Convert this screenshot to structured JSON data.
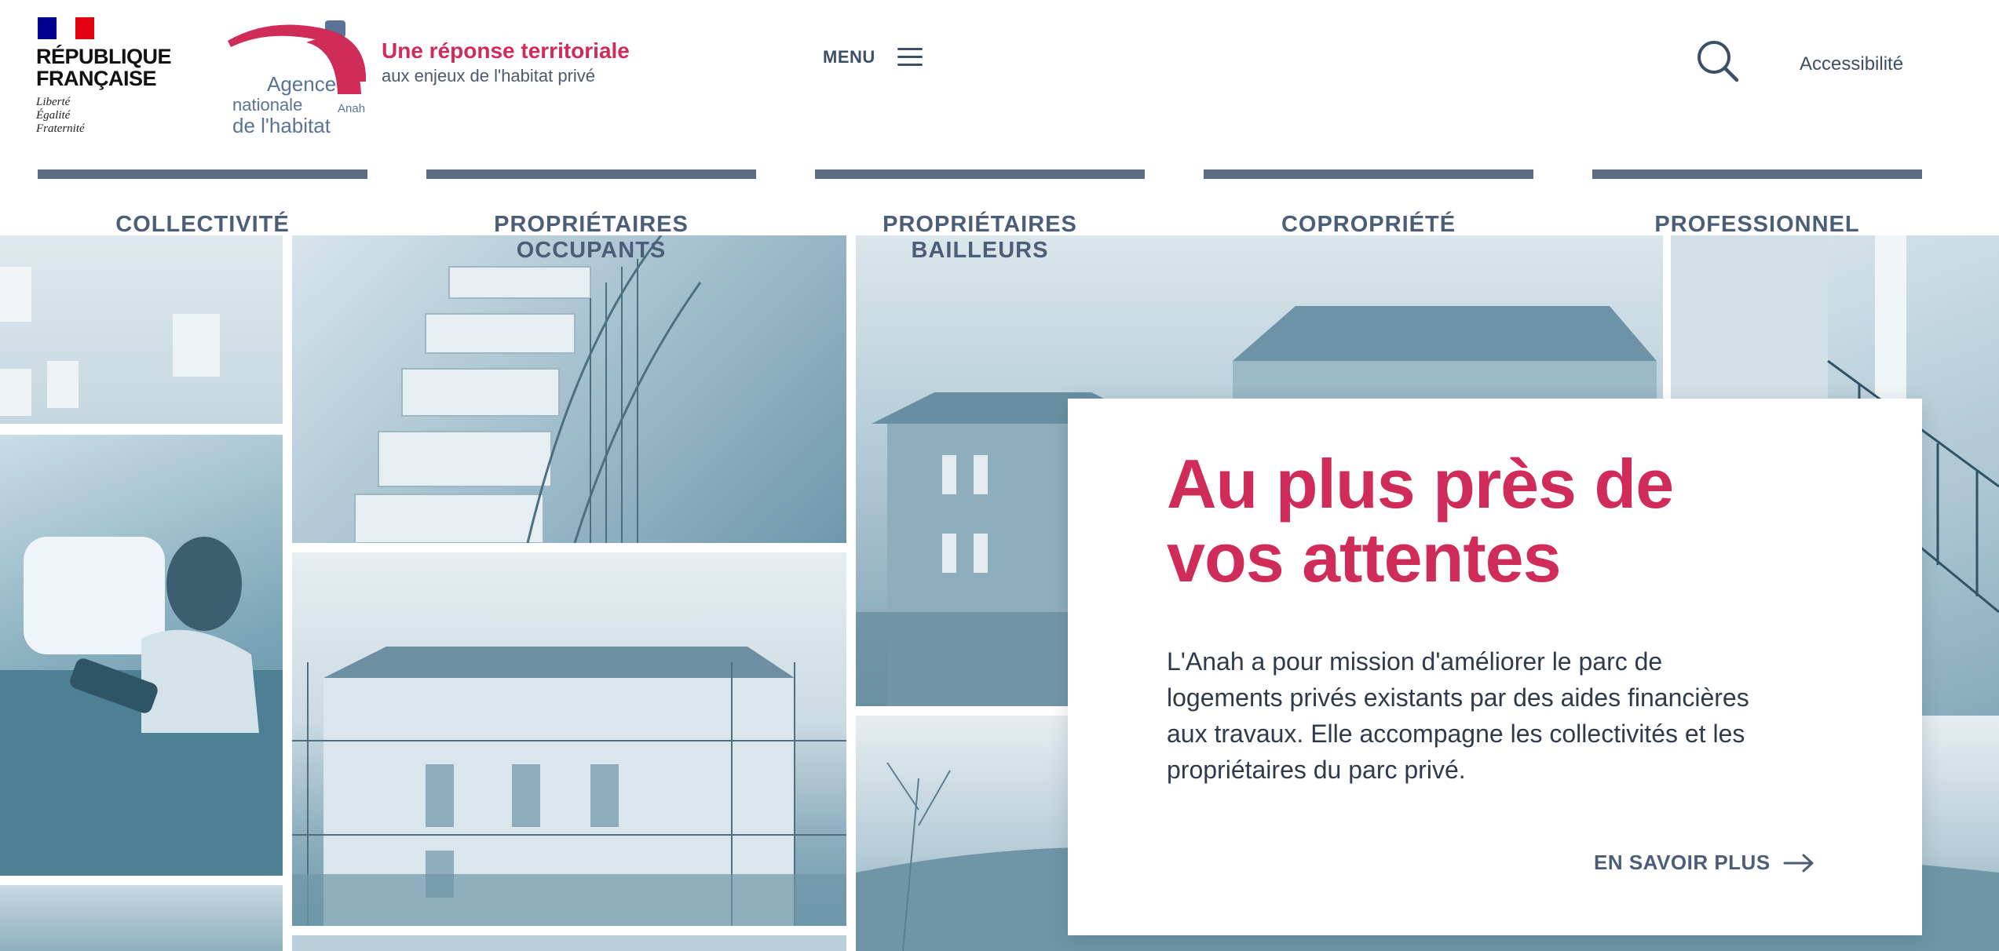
{
  "header": {
    "rf_name_line1": "RÉPUBLIQUE",
    "rf_name_line2": "FRANÇAISE",
    "rf_motto_1": "Liberté",
    "rf_motto_2": "Égalité",
    "rf_motto_3": "Fraternité",
    "anah_logo_agence": "Agence",
    "anah_logo_nationale": "nationale",
    "anah_logo_habitat": "de l'habitat",
    "anah_logo_anah": "Anah",
    "tagline_title": "Une réponse territoriale",
    "tagline_subtitle": "aux enjeux de l'habitat privé",
    "menu_label": "MENU",
    "accessibility_label": "Accessibilité"
  },
  "nav": {
    "items": [
      {
        "label": "COLLECTIVITÉ"
      },
      {
        "label": "PROPRIÉTAIRES OCCUPANTS"
      },
      {
        "label": "PROPRIÉTAIRES BAILLEURS"
      },
      {
        "label": "COPROPRIÉTÉ"
      },
      {
        "label": "PROFESSIONNEL"
      }
    ]
  },
  "hero": {
    "title": "Au plus près de vos attentes",
    "description": "L'Anah a pour mission d'améliorer le parc de logements privés existants par des aides financières aux travaux. Elle accompagne les collectivités et les propriétaires du parc privé.",
    "cta_label": "EN SAVOIR PLUS"
  },
  "colors": {
    "brand_pink": "#cf2c5a",
    "brand_slate": "#4c5e77",
    "photo_tint": "#7aa4b6"
  },
  "icons": [
    "search-icon",
    "menu-icon",
    "arrow-right-icon",
    "anah-logo",
    "marianne-logo"
  ]
}
